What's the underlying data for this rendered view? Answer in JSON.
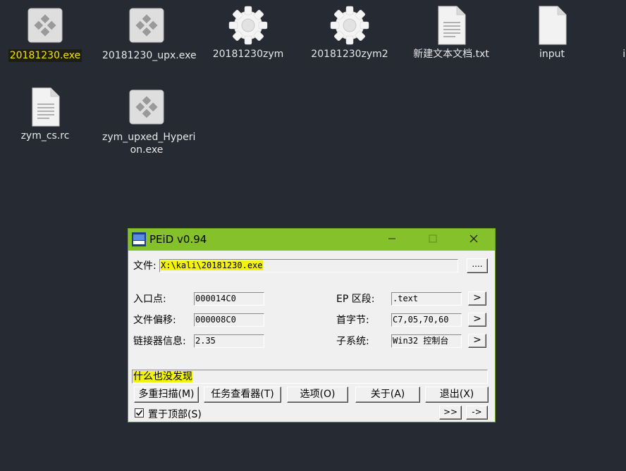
{
  "desktop": {
    "icons": [
      {
        "label": "20181230.exe",
        "type": "exe",
        "selected": true
      },
      {
        "label": "20181230_upx.exe",
        "type": "exe"
      },
      {
        "label": "20181230zym",
        "type": "gear"
      },
      {
        "label": "20181230zym2",
        "type": "gear"
      },
      {
        "label": "新建文本文档.txt",
        "type": "text"
      },
      {
        "label": "input",
        "type": "binary"
      },
      {
        "label": "in",
        "type": "partial"
      },
      {
        "label": "zym_cs.rc",
        "type": "text"
      },
      {
        "label_line1": "zym_upxed_Hyperi",
        "label_line2": "on.exe",
        "type": "exe"
      }
    ]
  },
  "peid": {
    "title": "PEiD v0.94",
    "file_label": "文件:",
    "file_path": "X:\\kali\\20181230.exe",
    "browse_label": "....",
    "entry_point_label": "入口点:",
    "entry_point_value": "000014C0",
    "file_offset_label": "文件偏移:",
    "file_offset_value": "000008C0",
    "linker_label": "链接器信息:",
    "linker_value": "2.35",
    "ep_section_label": "EP 区段:",
    "ep_section_value": ".text",
    "first_bytes_label": "首字节:",
    "first_bytes_value": "C7,05,70,60",
    "subsystem_label": "子系统:",
    "subsystem_value": "Win32 控制台",
    "arrow": ">",
    "result": "什么也没发现",
    "buttons": {
      "multi_scan": "多重扫描(M)",
      "task_viewer": "任务查看器(T)",
      "options": "选项(O)",
      "about": "关于(A)",
      "exit": "退出(X)"
    },
    "stay_on_top_label": "置于顶部(S)",
    "stay_on_top_checked": true,
    "ext_button": ">>",
    "arrow_button": "->"
  },
  "colors": {
    "desktop_bg": "#262a33",
    "titlebar": "#84c12a",
    "highlight": "#f2f20a"
  }
}
